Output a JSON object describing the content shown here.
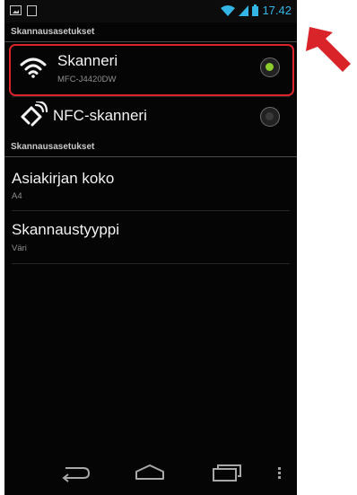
{
  "status_bar": {
    "time": "17.42"
  },
  "header": {
    "title": "Skannausasetukset"
  },
  "scanners": [
    {
      "title": "Skanneri",
      "subtitle": "MFC-J4420DW",
      "icon": "wifi-icon",
      "selected": true
    },
    {
      "title": "NFC-skanneri",
      "icon": "nfc-icon",
      "selected": false
    }
  ],
  "settings_section": {
    "title": "Skannausasetukset"
  },
  "settings": [
    {
      "title": "Asiakirjan koko",
      "value": "A4"
    },
    {
      "title": "Skannaustyyppi",
      "value": "Väri"
    }
  ],
  "navigation": {
    "back": "back-icon",
    "home": "home-icon",
    "recents": "recent-apps-icon",
    "menu": "overflow-menu-icon"
  },
  "colors": {
    "accent": "#33b5e5",
    "selected_radio": "#8ccd2e",
    "highlight": "#d9252a"
  }
}
